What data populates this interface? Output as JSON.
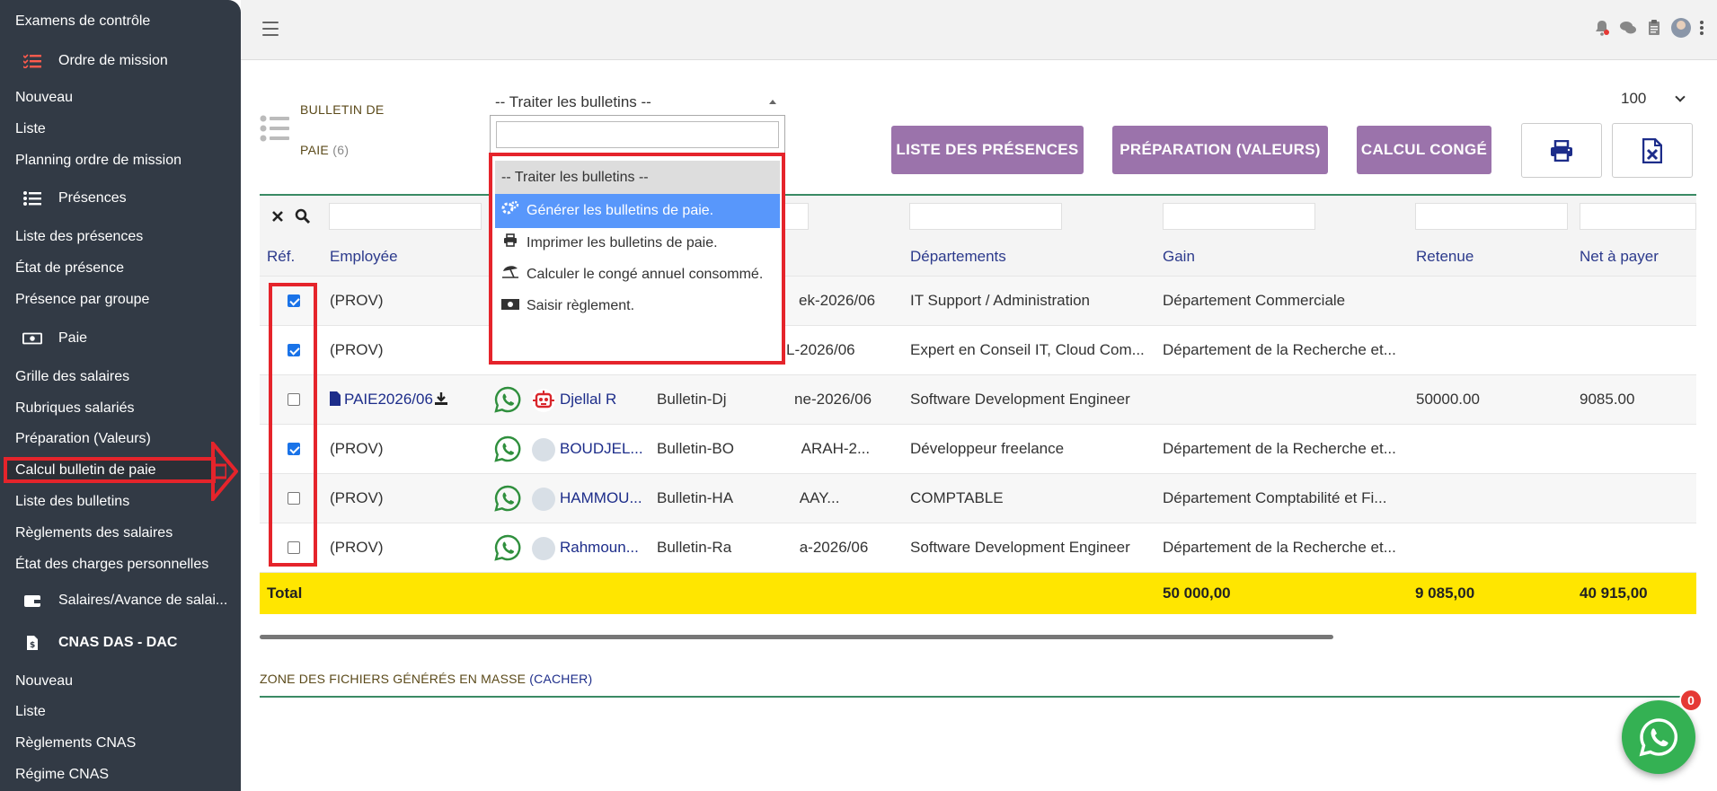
{
  "sidebar": {
    "items": [
      {
        "label": "Examens de contrôle",
        "type": "item"
      },
      {
        "label": "Ordre de mission",
        "type": "head",
        "icon": "list-icon"
      },
      {
        "label": "Nouveau",
        "type": "item"
      },
      {
        "label": "Liste",
        "type": "item"
      },
      {
        "label": "Planning ordre de mission",
        "type": "item"
      },
      {
        "label": "Présences",
        "type": "head",
        "icon": "list-icon"
      },
      {
        "label": "Liste des présences",
        "type": "item"
      },
      {
        "label": "État de présence",
        "type": "item"
      },
      {
        "label": "Présence par groupe",
        "type": "item"
      },
      {
        "label": "Paie",
        "type": "head",
        "icon": "money-icon"
      },
      {
        "label": "Grille des salaires",
        "type": "item"
      },
      {
        "label": "Rubriques salariés",
        "type": "item"
      },
      {
        "label": "Préparation (Valeurs)",
        "type": "item"
      },
      {
        "label": "Calcul bulletin de paie",
        "type": "item",
        "active": true
      },
      {
        "label": "Liste des bulletins",
        "type": "item"
      },
      {
        "label": "Règlements des salaires",
        "type": "item"
      },
      {
        "label": "État des charges personnelles",
        "type": "item"
      },
      {
        "label": "Salaires/Avance de salai...",
        "type": "head",
        "icon": "wallet-icon"
      },
      {
        "label": "CNAS DAS - DAC",
        "type": "head",
        "icon": "doc-dollar-icon"
      },
      {
        "label": "Nouveau",
        "type": "item"
      },
      {
        "label": "Liste",
        "type": "item"
      },
      {
        "label": "Règlements CNAS",
        "type": "item"
      },
      {
        "label": "Régime CNAS",
        "type": "item"
      }
    ]
  },
  "page": {
    "title_line1": "BULLETIN DE",
    "title_line2": "PAIE",
    "count": "(6)"
  },
  "select": {
    "value": "-- Traiter les bulletins --",
    "options": [
      {
        "label": "-- Traiter les bulletins --",
        "icon": ""
      },
      {
        "label": "Générer les bulletins de paie.",
        "icon": "gears-icon",
        "highlighted": true
      },
      {
        "label": "Imprimer les bulletins de paie.",
        "icon": "print-icon"
      },
      {
        "label": "Calculer le congé annuel consommé.",
        "icon": "beach-umbrella-icon"
      },
      {
        "label": "Saisir règlement.",
        "icon": "money-icon"
      }
    ]
  },
  "per_page": "100",
  "buttons": {
    "presences": "LISTE DES PRÉSENCES",
    "preparation": "PRÉPARATION (VALEURS)",
    "conge": "CALCUL CONGÉ"
  },
  "table": {
    "headers": [
      "Réf.",
      "Employée",
      "Départements",
      "Gain",
      "Retenue",
      "Net à payer"
    ],
    "rows": [
      {
        "checked": true,
        "ref": "(PROV)",
        "name": "",
        "bulletin": "ek-2026/06",
        "poste": "IT Support / Administration",
        "dept": "Département Commerciale",
        "retenue": "",
        "net": ""
      },
      {
        "checked": true,
        "ref": "(PROV)",
        "name": "",
        "bulletin": "BIL-2026/06",
        "poste": "Expert en Conseil IT, Cloud Com...",
        "dept": "Département de la Recherche et...",
        "retenue": "",
        "net": ""
      },
      {
        "checked": false,
        "ref": "PAIE2026/06",
        "name": "Djellal R",
        "bulletin": "Bulletin-Dj                ne-2026/06",
        "poste": "Software Development Engineer",
        "dept": "",
        "retenue": "50000.00",
        "net": "9085.00"
      },
      {
        "checked": true,
        "ref": "(PROV)",
        "name": "BOUDJEL...",
        "bulletin": "Bulletin-BO                ARAH-2...",
        "poste": "Développeur freelance",
        "dept": "Département de la Recherche et...",
        "retenue": "",
        "net": ""
      },
      {
        "checked": false,
        "ref": "(PROV)",
        "name": "HAMMOU...",
        "bulletin": "Bulletin-HA                AAY...",
        "poste": "COMPTABLE",
        "dept": "Département Comptabilité et Fi...",
        "retenue": "",
        "net": ""
      },
      {
        "checked": false,
        "ref": "(PROV)",
        "name": "Rahmoun...",
        "bulletin": "Bulletin-Ra                a-2026/06",
        "poste": "Software Development Engineer",
        "dept": "Département de la Recherche et...",
        "retenue": "",
        "net": ""
      }
    ],
    "total": {
      "label": "Total",
      "gain": "50 000,00",
      "retenue": "9 085,00",
      "net": "40 915,00"
    }
  },
  "zone": {
    "label": "ZONE DES FICHIERS GÉNÉRÉS EN MASSE",
    "link": "(CACHER)"
  },
  "chat": {
    "badge": "0"
  }
}
